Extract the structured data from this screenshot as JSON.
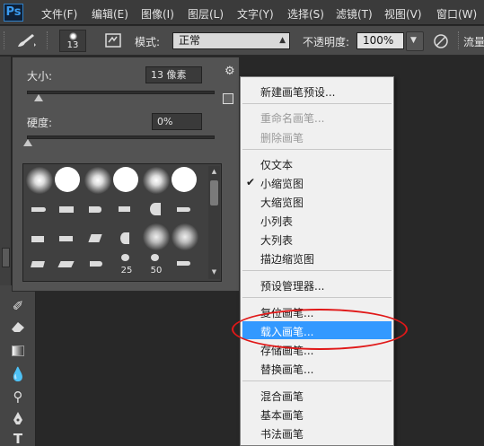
{
  "menubar": {
    "logo": "Ps",
    "items": [
      "文件(F)",
      "编辑(E)",
      "图像(I)",
      "图层(L)",
      "文字(Y)",
      "选择(S)",
      "滤镜(T)",
      "视图(V)",
      "窗口(W)"
    ]
  },
  "options_bar": {
    "brush_size": "13",
    "mode_label": "模式:",
    "mode_value": "正常",
    "opacity_label": "不透明度:",
    "opacity_value": "100%",
    "flow_label": "流量:"
  },
  "brush_panel": {
    "size_label": "大小:",
    "size_value": "13 像素",
    "hardness_label": "硬度:",
    "hardness_value": "0%",
    "preset_numbers": [
      "25",
      "50"
    ]
  },
  "context_menu": {
    "items": [
      {
        "label": "新建画笔预设...",
        "disabled": false
      },
      {
        "label": "重命名画笔...",
        "disabled": true
      },
      {
        "label": "删除画笔",
        "disabled": true
      },
      {
        "label": "仅文本",
        "disabled": false
      },
      {
        "label": "小缩览图",
        "disabled": false,
        "checked": true
      },
      {
        "label": "大缩览图",
        "disabled": false
      },
      {
        "label": "小列表",
        "disabled": false
      },
      {
        "label": "大列表",
        "disabled": false
      },
      {
        "label": "描边缩览图",
        "disabled": false
      },
      {
        "label": "预设管理器...",
        "disabled": false
      },
      {
        "label": "复位画笔...",
        "disabled": false
      },
      {
        "label": "载入画笔...",
        "disabled": false,
        "highlighted": true
      },
      {
        "label": "存储画笔...",
        "disabled": false
      },
      {
        "label": "替换画笔...",
        "disabled": false
      },
      {
        "label": "混合画笔",
        "disabled": false
      },
      {
        "label": "基本画笔",
        "disabled": false
      },
      {
        "label": "书法画笔",
        "disabled": false
      }
    ]
  },
  "colors": {
    "highlight": "#3399ff",
    "annotation_ellipse": "#e01818",
    "ps_logo": "#3a9bf0"
  }
}
